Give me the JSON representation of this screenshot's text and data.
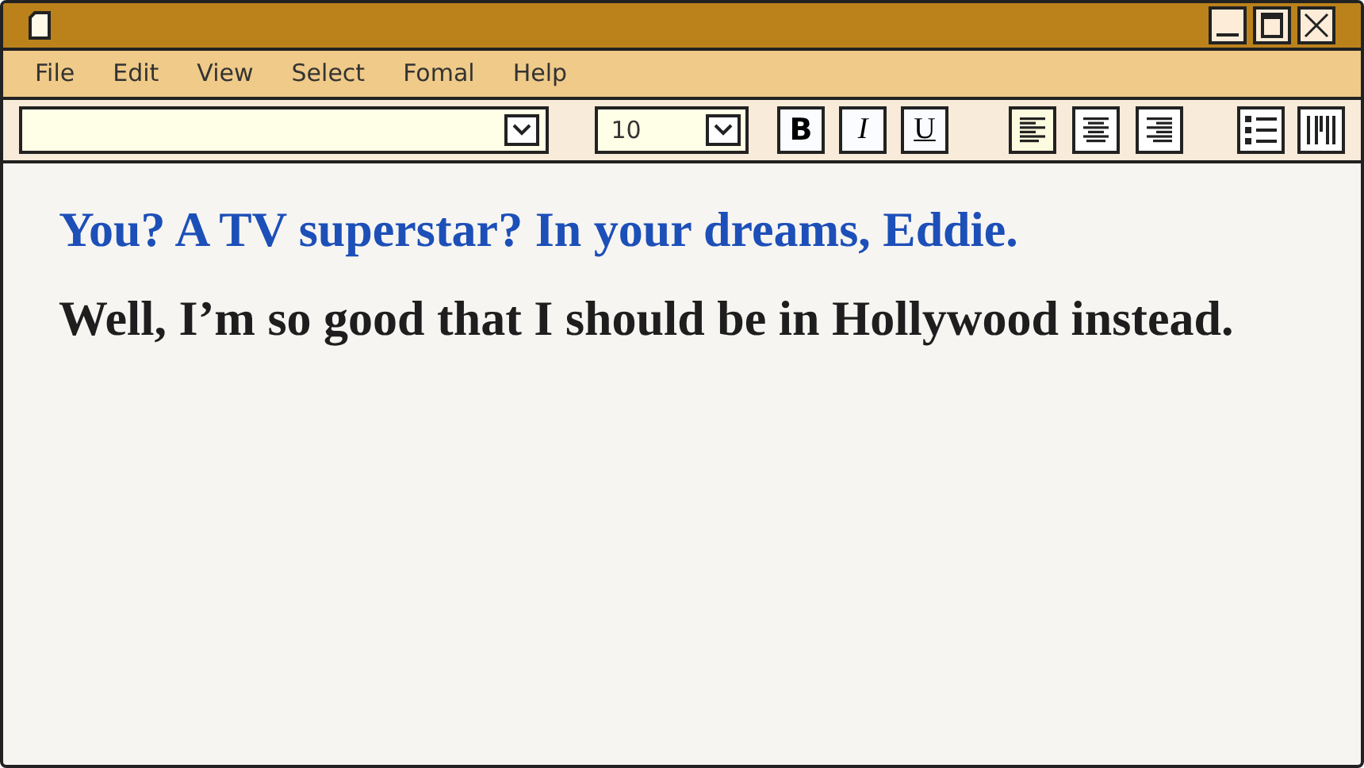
{
  "menu": [
    "File",
    "Edit",
    "View",
    "Select",
    "Fomal",
    "Help"
  ],
  "toolbar": {
    "font_size": "10",
    "styles": [
      {
        "kind": "bold",
        "label": "B",
        "selected": false
      },
      {
        "kind": "italic",
        "label": "I",
        "selected": false
      },
      {
        "kind": "underline",
        "label": "U",
        "selected": false
      }
    ],
    "align": [
      {
        "kind": "left",
        "selected": true
      },
      {
        "kind": "center",
        "selected": false
      },
      {
        "kind": "right",
        "selected": false
      }
    ]
  },
  "document": [
    {
      "text": "You? A TV superstar? In your dreams, Eddie.",
      "color": "#1d4fb8"
    },
    {
      "text": "Well, I’m so good that I should be in Hollywood instead.",
      "color": "#1e1e1e"
    }
  ]
}
